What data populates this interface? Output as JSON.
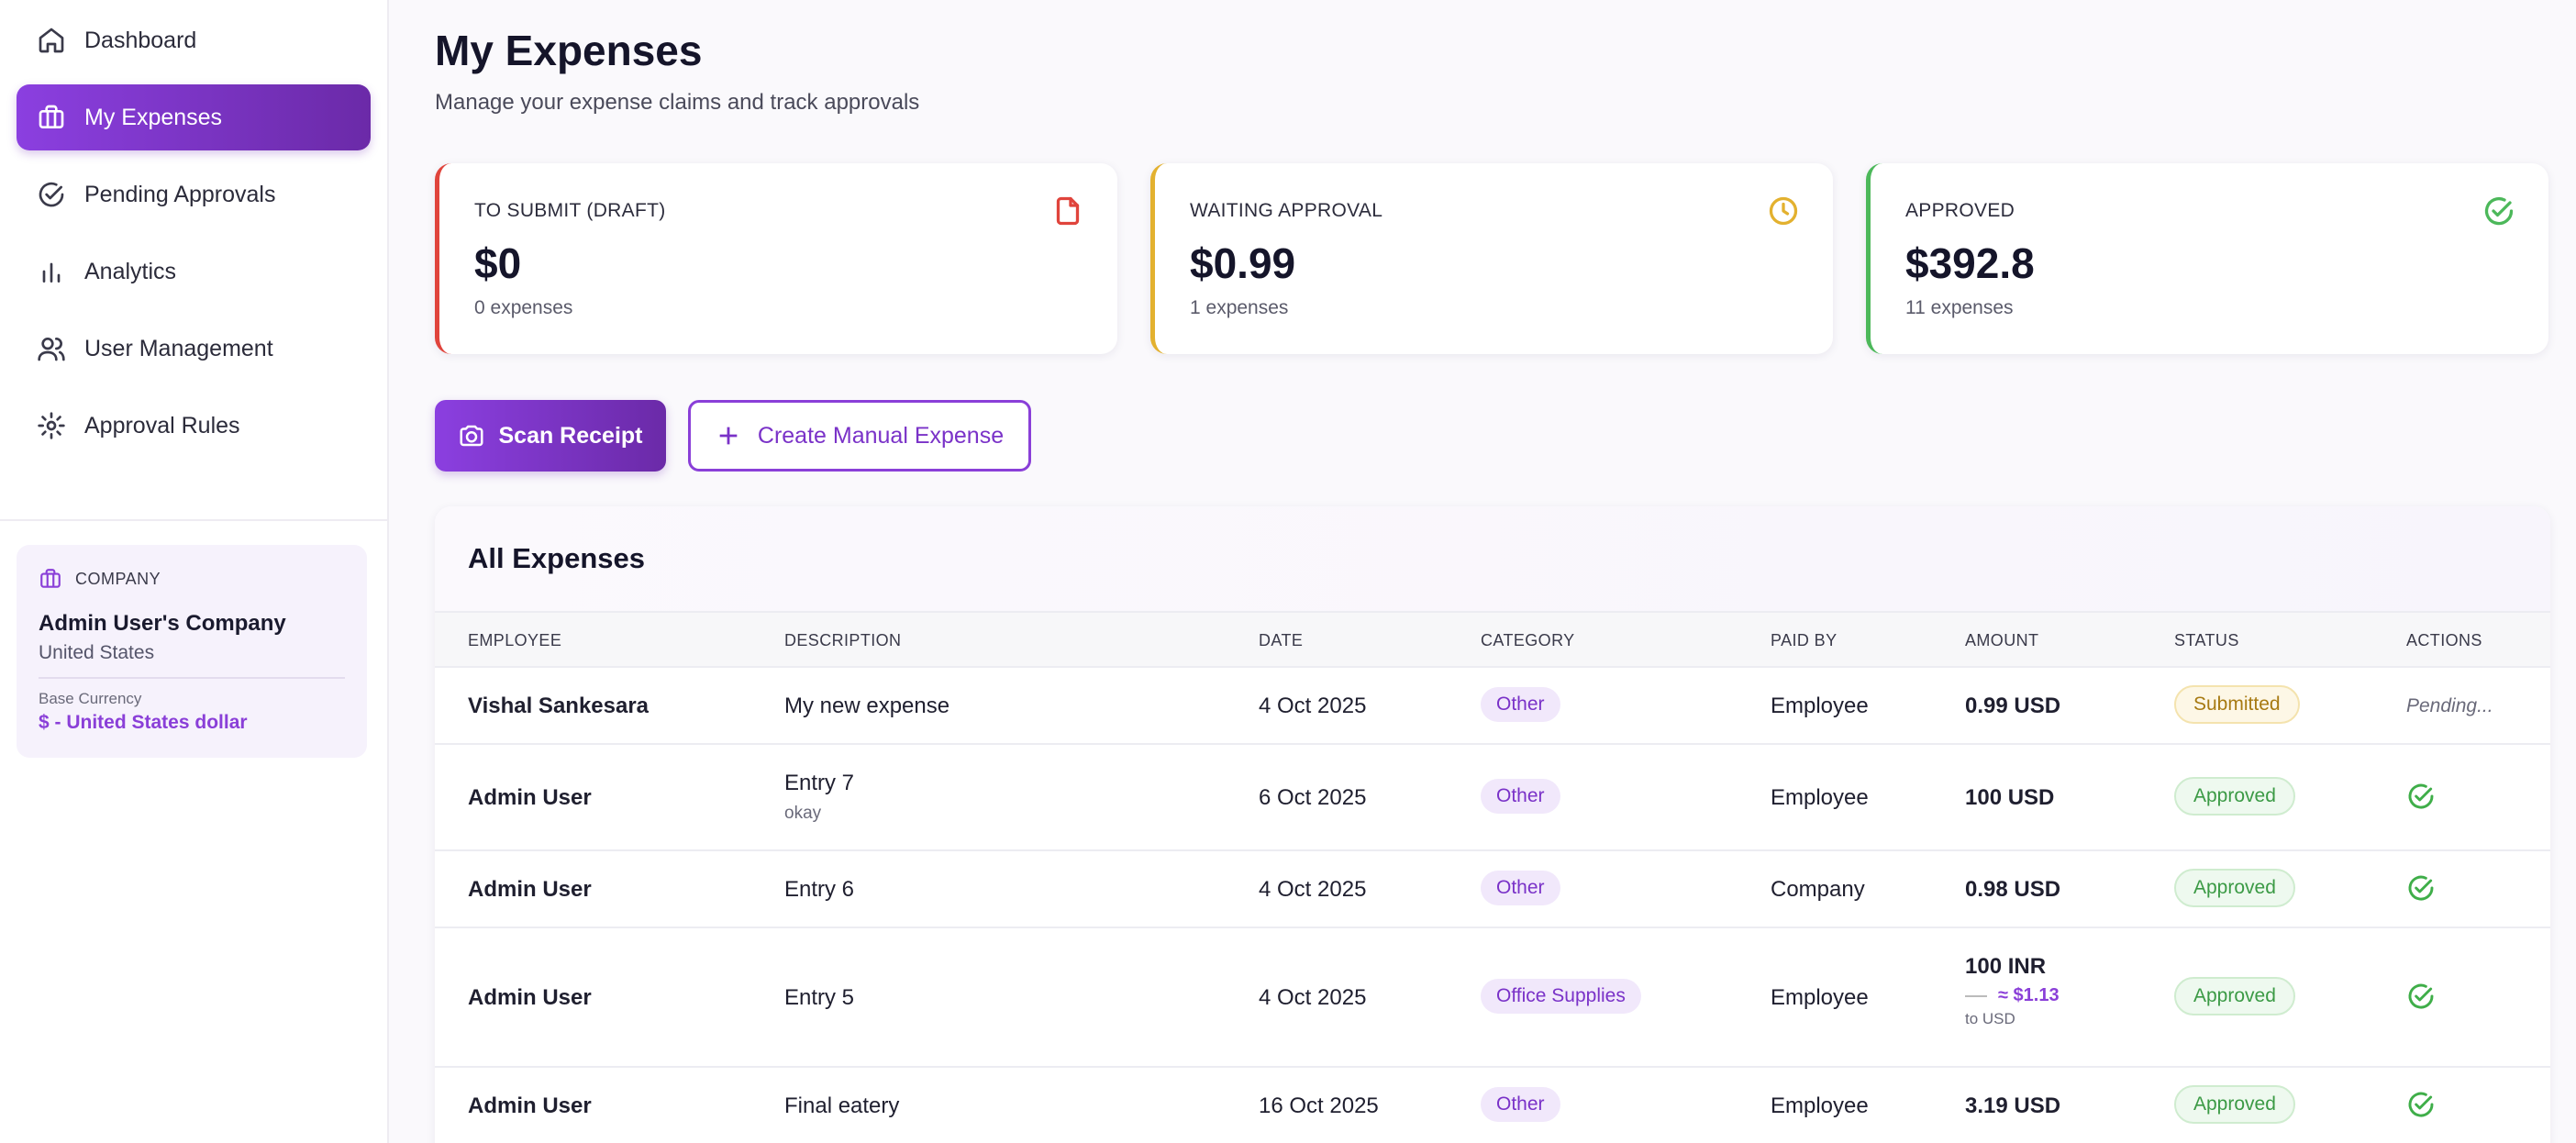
{
  "sidebar": {
    "items": [
      {
        "label": "Dashboard",
        "icon": "home-icon"
      },
      {
        "label": "My Expenses",
        "icon": "briefcase-icon",
        "active": true
      },
      {
        "label": "Pending Approvals",
        "icon": "check-circle-icon"
      },
      {
        "label": "Analytics",
        "icon": "bar-chart-icon"
      },
      {
        "label": "User Management",
        "icon": "users-icon"
      },
      {
        "label": "Approval Rules",
        "icon": "gear-icon"
      }
    ],
    "company": {
      "heading": "COMPANY",
      "name": "Admin User's Company",
      "country": "United States",
      "base_label": "Base Currency",
      "base_value": "$ - United States dollar"
    }
  },
  "header": {
    "title": "My Expenses",
    "subtitle": "Manage your expense claims and track approvals"
  },
  "stats": [
    {
      "label": "TO SUBMIT (DRAFT)",
      "value": "$0",
      "sub": "0 expenses",
      "color": "#e0443c",
      "icon": "file-icon"
    },
    {
      "label": "WAITING APPROVAL",
      "value": "$0.99",
      "sub": "1 expenses",
      "color": "#e3b12f",
      "icon": "clock-icon"
    },
    {
      "label": "APPROVED",
      "value": "$392.8",
      "sub": "11 expenses",
      "color": "#4cb85a",
      "icon": "check-circle-icon"
    }
  ],
  "actions": {
    "scan_label": "Scan Receipt",
    "create_label": "Create Manual Expense"
  },
  "table": {
    "title": "All Expenses",
    "columns": [
      "EMPLOYEE",
      "DESCRIPTION",
      "DATE",
      "CATEGORY",
      "PAID BY",
      "AMOUNT",
      "STATUS",
      "ACTIONS"
    ],
    "rows": [
      {
        "employee": "Vishal Sankesara",
        "description": "My new expense",
        "description_note": "",
        "date": "4 Oct 2025",
        "category": "Other",
        "paid_by": "Employee",
        "amount": "0.99 USD",
        "conversion": "",
        "conversion_note": "",
        "status": "Submitted",
        "action": "Pending..."
      },
      {
        "employee": "Admin User",
        "description": "Entry 7",
        "description_note": "okay",
        "date": "6 Oct 2025",
        "category": "Other",
        "paid_by": "Employee",
        "amount": "100 USD",
        "conversion": "",
        "conversion_note": "",
        "status": "Approved",
        "action": ""
      },
      {
        "employee": "Admin User",
        "description": "Entry 6",
        "description_note": "",
        "date": "4 Oct 2025",
        "category": "Other",
        "paid_by": "Company",
        "amount": "0.98 USD",
        "conversion": "",
        "conversion_note": "",
        "status": "Approved",
        "action": ""
      },
      {
        "employee": "Admin User",
        "description": "Entry 5",
        "description_note": "",
        "date": "4 Oct 2025",
        "category": "Office Supplies",
        "paid_by": "Employee",
        "amount": "100 INR",
        "conversion": "≈ $1.13",
        "conversion_note": "to USD",
        "status": "Approved",
        "action": ""
      },
      {
        "employee": "Admin User",
        "description": "Final eatery",
        "description_note": "",
        "date": "16 Oct 2025",
        "category": "Other",
        "paid_by": "Employee",
        "amount": "3.19 USD",
        "conversion": "",
        "conversion_note": "",
        "status": "Approved",
        "action": ""
      }
    ]
  }
}
